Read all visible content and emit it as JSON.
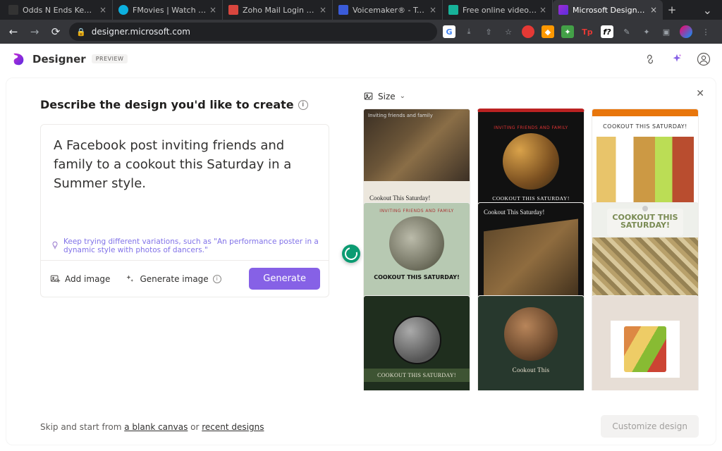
{
  "browser": {
    "tabs": [
      {
        "title": "Odds N Ends Kenya"
      },
      {
        "title": "FMovies | Watch Movies On"
      },
      {
        "title": "Zoho Mail Login - Sign in t"
      },
      {
        "title": "Voicemaker® - Text to Spe"
      },
      {
        "title": "Free online video template"
      },
      {
        "title": "Microsoft Designer - Stun",
        "active": true
      }
    ],
    "url": "designer.microsoft.com"
  },
  "header": {
    "app_name": "Designer",
    "badge": "PREVIEW"
  },
  "left": {
    "heading": "Describe the design you'd like to create",
    "prompt": "A Facebook post inviting friends and family to a cookout this Saturday in a Summer style.",
    "hint": "Keep trying different variations, such as \"An performance poster in a dynamic style with photos of dancers.\"",
    "add_image": "Add image",
    "generate_image": "Generate image",
    "generate_btn": "Generate",
    "skip_pre": "Skip and start from ",
    "skip_blank": "a blank canvas",
    "skip_or": " or ",
    "skip_recent": "recent designs"
  },
  "right": {
    "size_label": "Size",
    "customize": "Customize design",
    "cards": {
      "c1_small": "Inviting friends and family",
      "c1_cap": "Cookout This Saturday!",
      "c2_top": "INVITING FRIENDS AND FAMILY",
      "c2_cap": "COOKOUT THIS SATURDAY!",
      "c3_cap": "COOKOUT THIS SATURDAY!",
      "c4_top": "INVITING FRIENDS AND FAMILY",
      "c4_cap": "COOKOUT THIS SATURDAY!",
      "c5_cap": "Cookout This Saturday!",
      "c6_cap": "COOKOUT THIS SATURDAY!",
      "c7_cap": "COOKOUT THIS SATURDAY!",
      "c8_cap": "Cookout This"
    }
  }
}
